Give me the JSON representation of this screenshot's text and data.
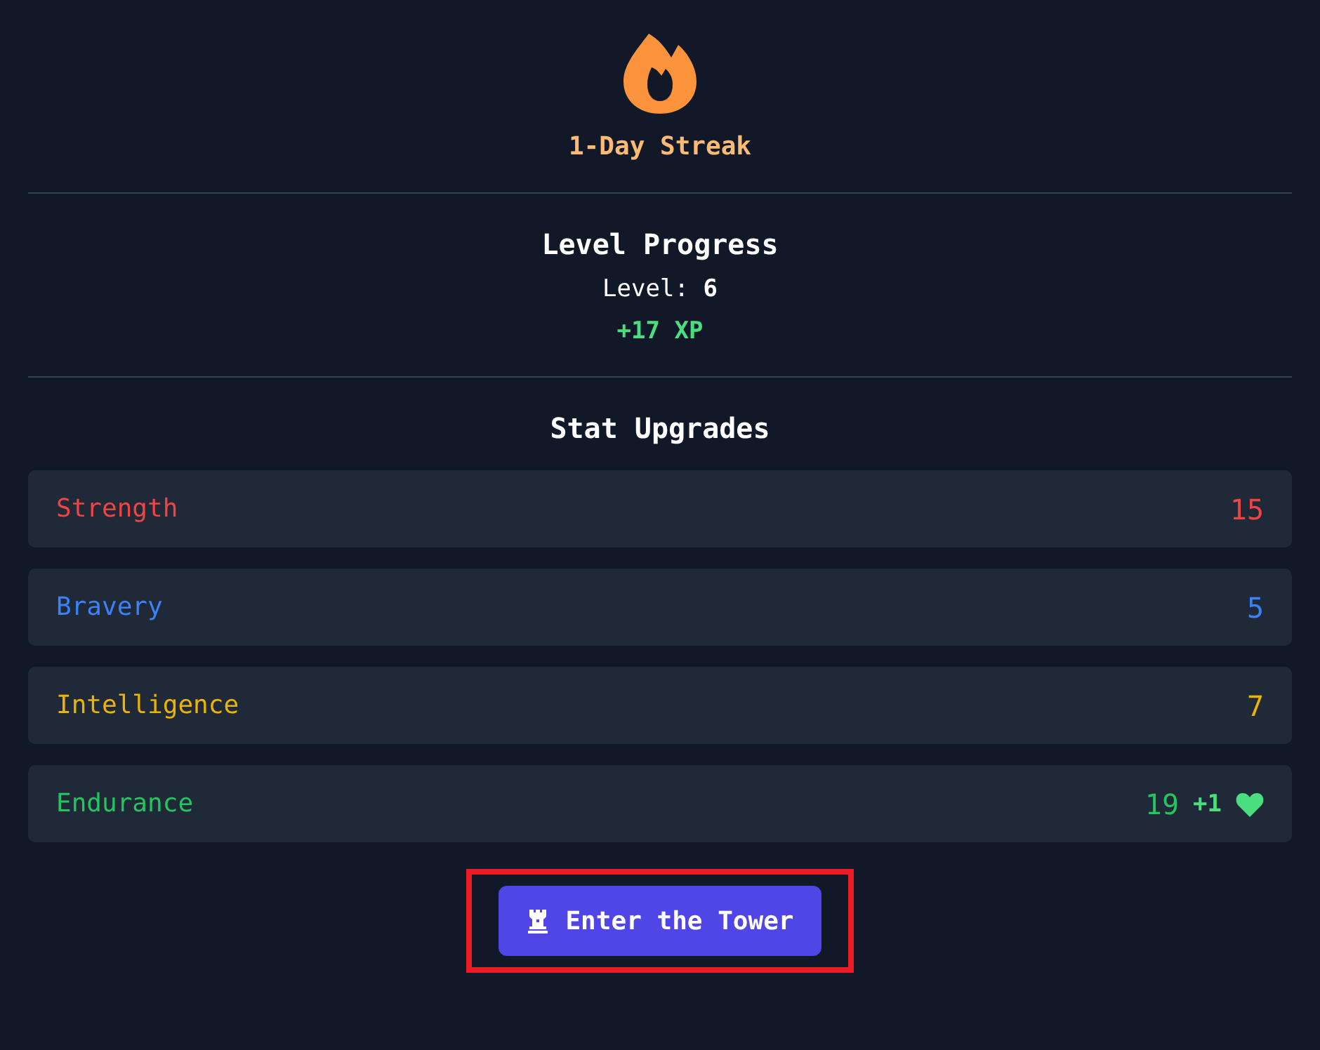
{
  "streak": {
    "label": "1-Day Streak"
  },
  "level_progress": {
    "title": "Level Progress",
    "level": "Level: **6**",
    "xp": "+17 XP"
  },
  "stat_upgrades": {
    "title": "Stat Upgrades",
    "stats": [
      {
        "name": "Strength",
        "value": "15",
        "color": "#ef4444"
      },
      {
        "name": "Bravery",
        "value": "5",
        "color": "#3b82f6"
      },
      {
        "name": "Intelligence",
        "value": "7",
        "color": "#eab308"
      },
      {
        "name": "Endurance",
        "value": "19",
        "color": "#22c55e",
        "bonus": "+1"
      }
    ]
  },
  "action_button": {
    "label": "Enter the Tower",
    "highlighted": true
  }
}
